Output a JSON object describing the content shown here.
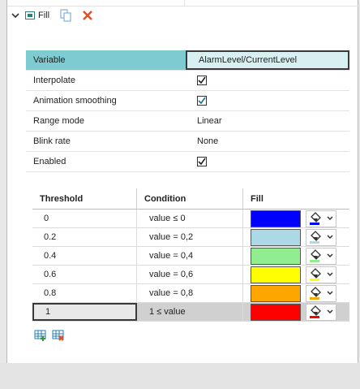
{
  "header": {
    "title": "Fill"
  },
  "properties": [
    {
      "key": "Variable",
      "value": "AlarmLevel/CurrentLevel",
      "type": "text"
    },
    {
      "key": "Interpolate",
      "value": "",
      "type": "checkbox",
      "checked": true
    },
    {
      "key": "Animation smoothing",
      "value": "",
      "type": "checkbox",
      "checked": true
    },
    {
      "key": "Range mode",
      "value": "Linear",
      "type": "text"
    },
    {
      "key": "Blink rate",
      "value": "None",
      "type": "text"
    },
    {
      "key": "Enabled",
      "value": "",
      "type": "checkbox",
      "checked": true
    }
  ],
  "thresholds": {
    "columns": [
      "Threshold",
      "Condition",
      "Fill"
    ],
    "rows": [
      {
        "threshold": "0",
        "condition": "value ≤ 0",
        "color": "#0000ff"
      },
      {
        "threshold": "0.2",
        "condition": "value = 0,2",
        "color": "#add8e6"
      },
      {
        "threshold": "0.4",
        "condition": "value = 0,4",
        "color": "#90ee90"
      },
      {
        "threshold": "0.6",
        "condition": "value = 0,6",
        "color": "#ffff00"
      },
      {
        "threshold": "0.8",
        "condition": "value = 0,8",
        "color": "#ffa500"
      },
      {
        "threshold": "1",
        "condition": "1 ≤ value",
        "color": "#ff0000"
      }
    ]
  },
  "colors": {
    "accent": "#7ecbd1",
    "delete": "#e0502a"
  }
}
